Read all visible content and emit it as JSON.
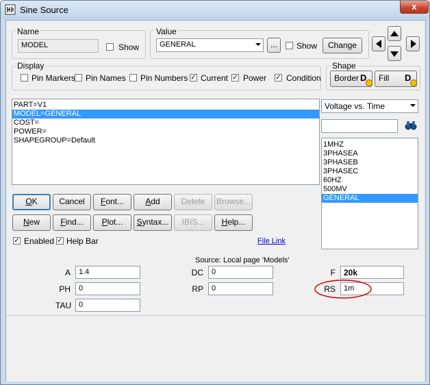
{
  "window": {
    "title": "Sine Source",
    "close_glyph": "x"
  },
  "name_group": {
    "label": "Name",
    "value": "MODEL",
    "show_label": "Show",
    "show_checked": false
  },
  "value_group": {
    "label": "Value",
    "value": "GENERAL",
    "ellipsis_label": "...",
    "show_label": "Show",
    "show_checked": false,
    "change_label": "Change"
  },
  "display_group": {
    "label": "Display",
    "options": [
      {
        "label": "Pin Markers",
        "checked": false
      },
      {
        "label": "Pin Names",
        "checked": false
      },
      {
        "label": "Pin Numbers",
        "checked": false
      },
      {
        "label": "Current",
        "checked": true
      },
      {
        "label": "Power",
        "checked": true
      },
      {
        "label": "Condition",
        "checked": true
      }
    ]
  },
  "shape_group": {
    "label": "Shape",
    "border_label": "Border",
    "fill_label": "Fill",
    "badge": "D"
  },
  "attributes": [
    {
      "text": "PART=V1",
      "selected": false
    },
    {
      "text": "MODEL=GENERAL",
      "selected": true
    },
    {
      "text": "COST=",
      "selected": false
    },
    {
      "text": "POWER=",
      "selected": false
    },
    {
      "text": "SHAPEGROUP=Default",
      "selected": false
    }
  ],
  "plot_select": {
    "value": "Voltage vs. Time"
  },
  "search": {
    "value": ""
  },
  "models": [
    {
      "text": "1MHZ",
      "selected": false
    },
    {
      "text": "3PHASEA",
      "selected": false
    },
    {
      "text": "3PHASEB",
      "selected": false
    },
    {
      "text": "3PHASEC",
      "selected": false
    },
    {
      "text": "60HZ",
      "selected": false
    },
    {
      "text": "500MV",
      "selected": false
    },
    {
      "text": "GENERAL",
      "selected": true
    }
  ],
  "buttons_row1": {
    "ok": {
      "label": "OK",
      "key": "O",
      "rest": "K"
    },
    "cancel": {
      "label": "Cancel"
    },
    "font": {
      "label": "Font...",
      "key": "F",
      "rest": "ont..."
    },
    "add": {
      "label": "Add",
      "key": "A",
      "rest": "dd"
    },
    "delete": {
      "label": "Delete"
    },
    "browse": {
      "label": "Browse..."
    }
  },
  "buttons_row2": {
    "new": {
      "label": "New",
      "key": "N",
      "rest": "ew"
    },
    "find": {
      "label": "Find...",
      "key": "F",
      "rest": "ind..."
    },
    "plot": {
      "label": "Plot...",
      "key": "P",
      "rest": "lot..."
    },
    "syntax": {
      "label": "Syntax...",
      "key": "S",
      "rest": "yntax..."
    },
    "ibis": {
      "label": "IBIS..."
    },
    "help": {
      "label": "Help...",
      "key": "H",
      "rest": "elp..."
    }
  },
  "enabled": {
    "label": "Enabled",
    "checked": true
  },
  "help_bar": {
    "label": "Help Bar",
    "checked": true
  },
  "file_link": "File Link",
  "source_note": "Source: Local page 'Models'",
  "params": {
    "A": {
      "label": "A",
      "value": "1.4"
    },
    "PH": {
      "label": "PH",
      "value": "0"
    },
    "TAU": {
      "label": "TAU",
      "value": "0"
    },
    "DC": {
      "label": "DC",
      "value": "0"
    },
    "RP": {
      "label": "RP",
      "value": "0"
    },
    "F": {
      "label": "F",
      "value": "20k"
    },
    "RS": {
      "label": "RS",
      "value": "1m"
    }
  },
  "colors": {
    "selection": "#3399ff",
    "highlight_ellipse": "#cc0000",
    "link": "#0000cc"
  }
}
